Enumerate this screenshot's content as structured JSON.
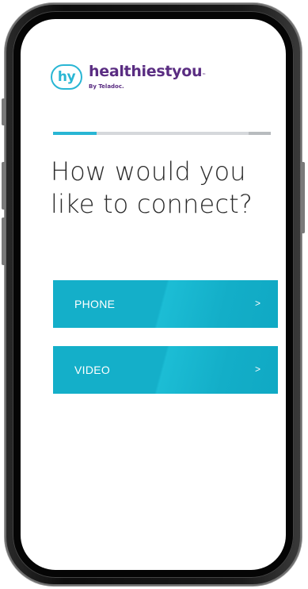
{
  "brand": {
    "badge": "hy",
    "name": "healthiestyou",
    "trademark": "™",
    "byline": "By Teladoc."
  },
  "progress": {
    "fraction": 0.2
  },
  "prompt": {
    "line1": "How would you",
    "line2": "like to connect?"
  },
  "options": [
    {
      "label": "PHONE",
      "chevron": ">"
    },
    {
      "label": "VIDEO",
      "chevron": ">"
    }
  ],
  "colors": {
    "accent": "#29b6d4",
    "brand_purple": "#5a2d82",
    "button": "#14afc9"
  }
}
